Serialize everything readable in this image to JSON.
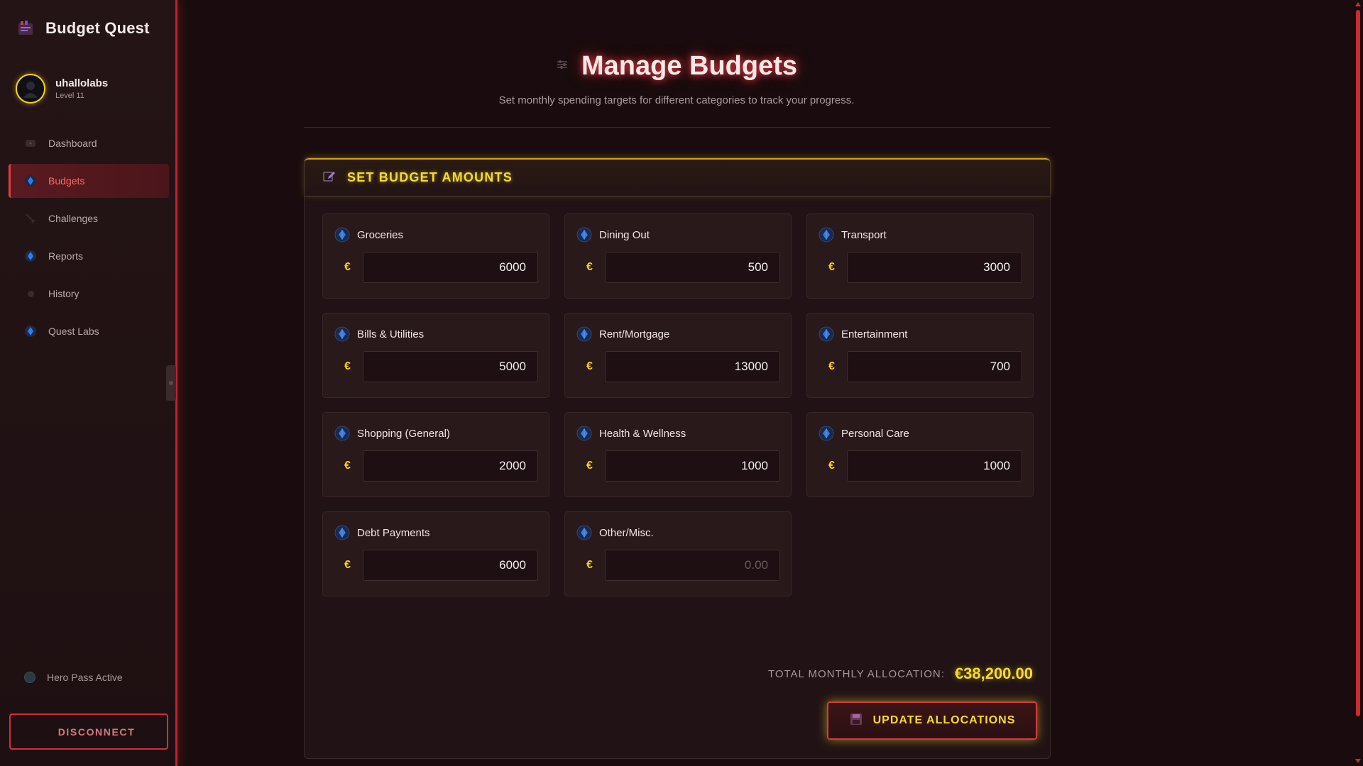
{
  "app": {
    "title": "Budget Quest"
  },
  "user": {
    "name": "uhallolabs",
    "level": "Level 11"
  },
  "sidebar": {
    "items": [
      {
        "label": "Dashboard",
        "icon": "dashboard-icon"
      },
      {
        "label": "Budgets",
        "icon": "gem-icon",
        "active": true
      },
      {
        "label": "Challenges",
        "icon": "sword-icon"
      },
      {
        "label": "Reports",
        "icon": "gem-icon"
      },
      {
        "label": "History",
        "icon": "history-icon"
      },
      {
        "label": "Quest Labs",
        "icon": "gem-icon"
      }
    ],
    "hero_pass": "Hero Pass Active",
    "disconnect": "DISCONNECT"
  },
  "header": {
    "title": "Manage Budgets",
    "subtitle": "Set monthly spending targets for different categories to track your progress."
  },
  "panel": {
    "title": "SET BUDGET AMOUNTS",
    "currency_symbol": "€",
    "categories": [
      {
        "label": "Groceries",
        "value": "6000",
        "placeholder": "0.00"
      },
      {
        "label": "Dining Out",
        "value": "500",
        "placeholder": "0.00"
      },
      {
        "label": "Transport",
        "value": "3000",
        "placeholder": "0.00"
      },
      {
        "label": "Bills & Utilities",
        "value": "5000",
        "placeholder": "0.00"
      },
      {
        "label": "Rent/Mortgage",
        "value": "13000",
        "placeholder": "0.00"
      },
      {
        "label": "Entertainment",
        "value": "700",
        "placeholder": "0.00"
      },
      {
        "label": "Shopping (General)",
        "value": "2000",
        "placeholder": "0.00"
      },
      {
        "label": "Health & Wellness",
        "value": "1000",
        "placeholder": "0.00"
      },
      {
        "label": "Personal Care",
        "value": "1000",
        "placeholder": "0.00"
      },
      {
        "label": "Debt Payments",
        "value": "6000",
        "placeholder": "0.00"
      },
      {
        "label": "Other/Misc.",
        "value": "",
        "placeholder": "0.00"
      }
    ],
    "total_label": "TOTAL MONTHLY ALLOCATION:",
    "total_value": "€38,200.00",
    "update_button": "UPDATE ALLOCATIONS"
  },
  "colors": {
    "accent_red": "#c9343b",
    "accent_yellow": "#f6dc2a",
    "background": "#1a0c0e",
    "gem_blue": "#2d6fd8"
  }
}
